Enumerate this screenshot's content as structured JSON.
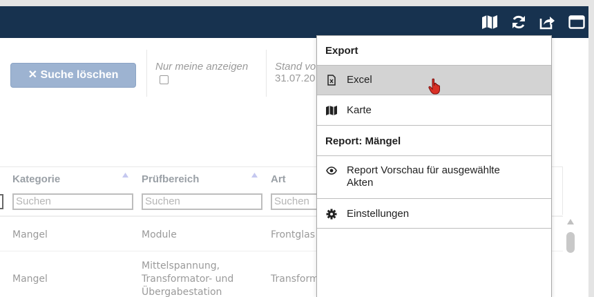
{
  "toolbar": {
    "icons": [
      "map-icon",
      "refresh-icon",
      "share-icon",
      "window-icon"
    ]
  },
  "filters": {
    "clear_search_label": "✕ Suche löschen",
    "only_mine_label": "Nur meine anzeigen",
    "only_mine_checked": false,
    "stand_label": "Stand vo",
    "stand_date": "31.07.20"
  },
  "table": {
    "columns": [
      {
        "label": "Kategorie",
        "placeholder": "Suchen"
      },
      {
        "label": "Prüfbereich",
        "placeholder": "Suchen"
      },
      {
        "label": "Art",
        "placeholder": "Suchen"
      }
    ],
    "rows": [
      {
        "kategorie": "Mangel",
        "pruefbereich": [
          "Module"
        ],
        "art": "Frontglas"
      },
      {
        "kategorie": "Mangel",
        "pruefbereich": [
          "Mittelspannung,",
          "Transformator- und",
          "Übergabestation"
        ],
        "art": "Transform"
      }
    ]
  },
  "menu": {
    "export_header": "Export",
    "excel_label": "Excel",
    "karte_label": "Karte",
    "report_header": "Report: Mängel",
    "report_preview_line1": "Report Vorschau für ausgewählte",
    "report_preview_line2": "Akten",
    "settings_label": "Einstellungen",
    "hovered_item": "Excel"
  },
  "colors": {
    "topbar": "#17324f",
    "clear_button": "#9db3d1",
    "hover": "#d3d3d3",
    "cursor": "#d93025"
  }
}
